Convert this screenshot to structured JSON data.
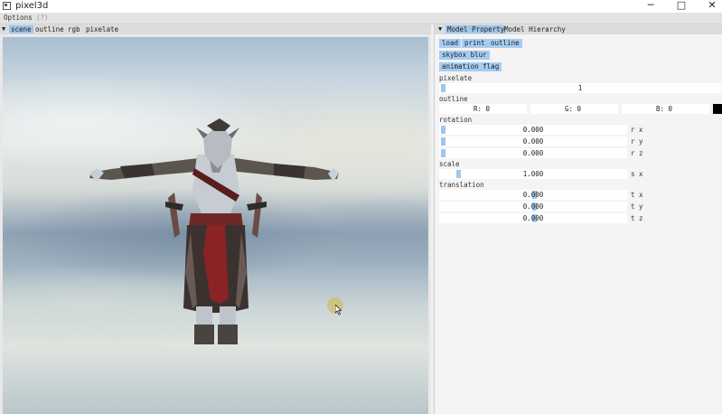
{
  "window": {
    "title": "pixel3d",
    "minimize_glyph": "─",
    "maximize_glyph": "□",
    "close_glyph": "✕"
  },
  "menu": {
    "options": "Options",
    "help": "(?)"
  },
  "left_tabs": {
    "arrow": "▼",
    "items": [
      "scene",
      "outline",
      "rgb",
      "pixelate"
    ],
    "active": "scene"
  },
  "right_tabs": {
    "arrow": "▼",
    "items": [
      "Model Property",
      "Model Hierarchy"
    ],
    "active": "Model Property"
  },
  "buttons": {
    "load": "load",
    "print": "print",
    "outline": "outline",
    "skybox_blur": "skybox blur",
    "animation_flag": "animation flag"
  },
  "pixelate": {
    "label": "pixelate",
    "value": "1"
  },
  "outline": {
    "label": "outline",
    "r": "R: 0",
    "g": "G: 0",
    "b": "B: 0",
    "color": "#000000"
  },
  "rotation": {
    "label": "rotation",
    "x": "0.000",
    "y": "0.000",
    "z": "0.000",
    "x_axis": "r x",
    "y_axis": "r y",
    "z_axis": "r z"
  },
  "scale": {
    "label": "scale",
    "x": "1.000",
    "x_axis": "s x"
  },
  "translation": {
    "label": "translation",
    "x": "0.000",
    "y": "0.000",
    "z": "0.000",
    "x_axis": "t x",
    "y_axis": "t y",
    "z_axis": "t z"
  },
  "colors": {
    "accent": "#a5cdf2",
    "active_tab": "#9fc6ea",
    "slider_grab": "#9ec6ef"
  }
}
